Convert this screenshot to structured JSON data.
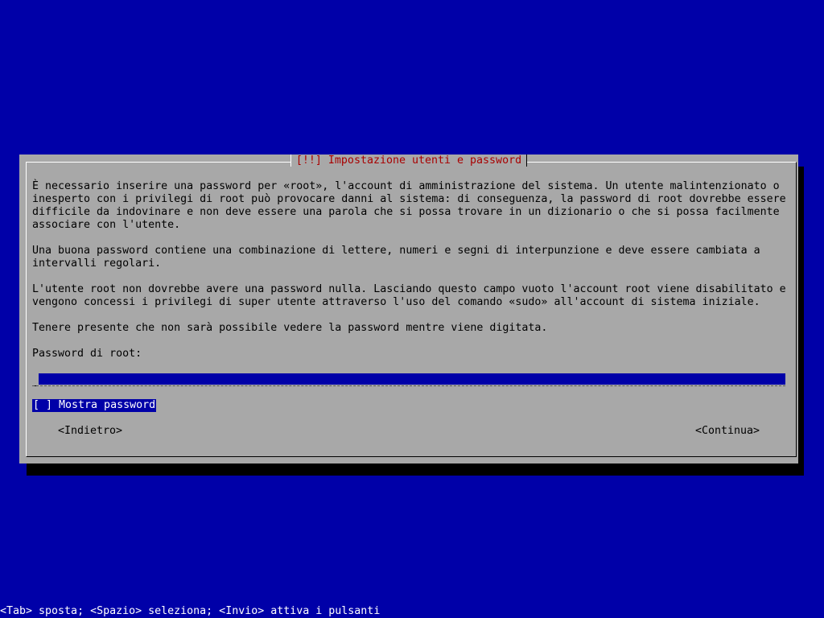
{
  "dialog": {
    "title": "[!!] Impostazione utenti e password",
    "paragraphs": [
      "È necessario inserire una password per «root», l'account di amministrazione del sistema. Un utente malintenzionato o\ninesperto con i privilegi di root può provocare danni al sistema: di conseguenza, la password di root dovrebbe essere\ndifficile da indovinare e non deve essere una parola che si possa trovare in un dizionario o che si possa facilmente\nassociare con l'utente.",
      "Una buona password contiene una combinazione di lettere, numeri e segni di interpunzione e deve essere cambiata a\nintervalli regolari.",
      "L'utente root non dovrebbe avere una password nulla. Lasciando questo campo vuoto l'account root viene disabilitato e\nvengono concessi i privilegi di super utente attraverso l'uso del comando «sudo» all'account di sistema iniziale.",
      "Tenere presente che non sarà possibile vedere la password mentre viene digitata."
    ],
    "password_label": "Password di root:",
    "password_value": "",
    "show_password_checkbox": "[ ] Mostra password",
    "back_button": "<Indietro>",
    "continue_button": "<Continua>"
  },
  "help_bar": "<Tab> sposta; <Spazio> seleziona; <Invio> attiva i pulsanti",
  "colors": {
    "background": "#0000a8",
    "dialog": "#a8a8a8",
    "title_text": "#a80000",
    "highlight": "#0000a8"
  }
}
